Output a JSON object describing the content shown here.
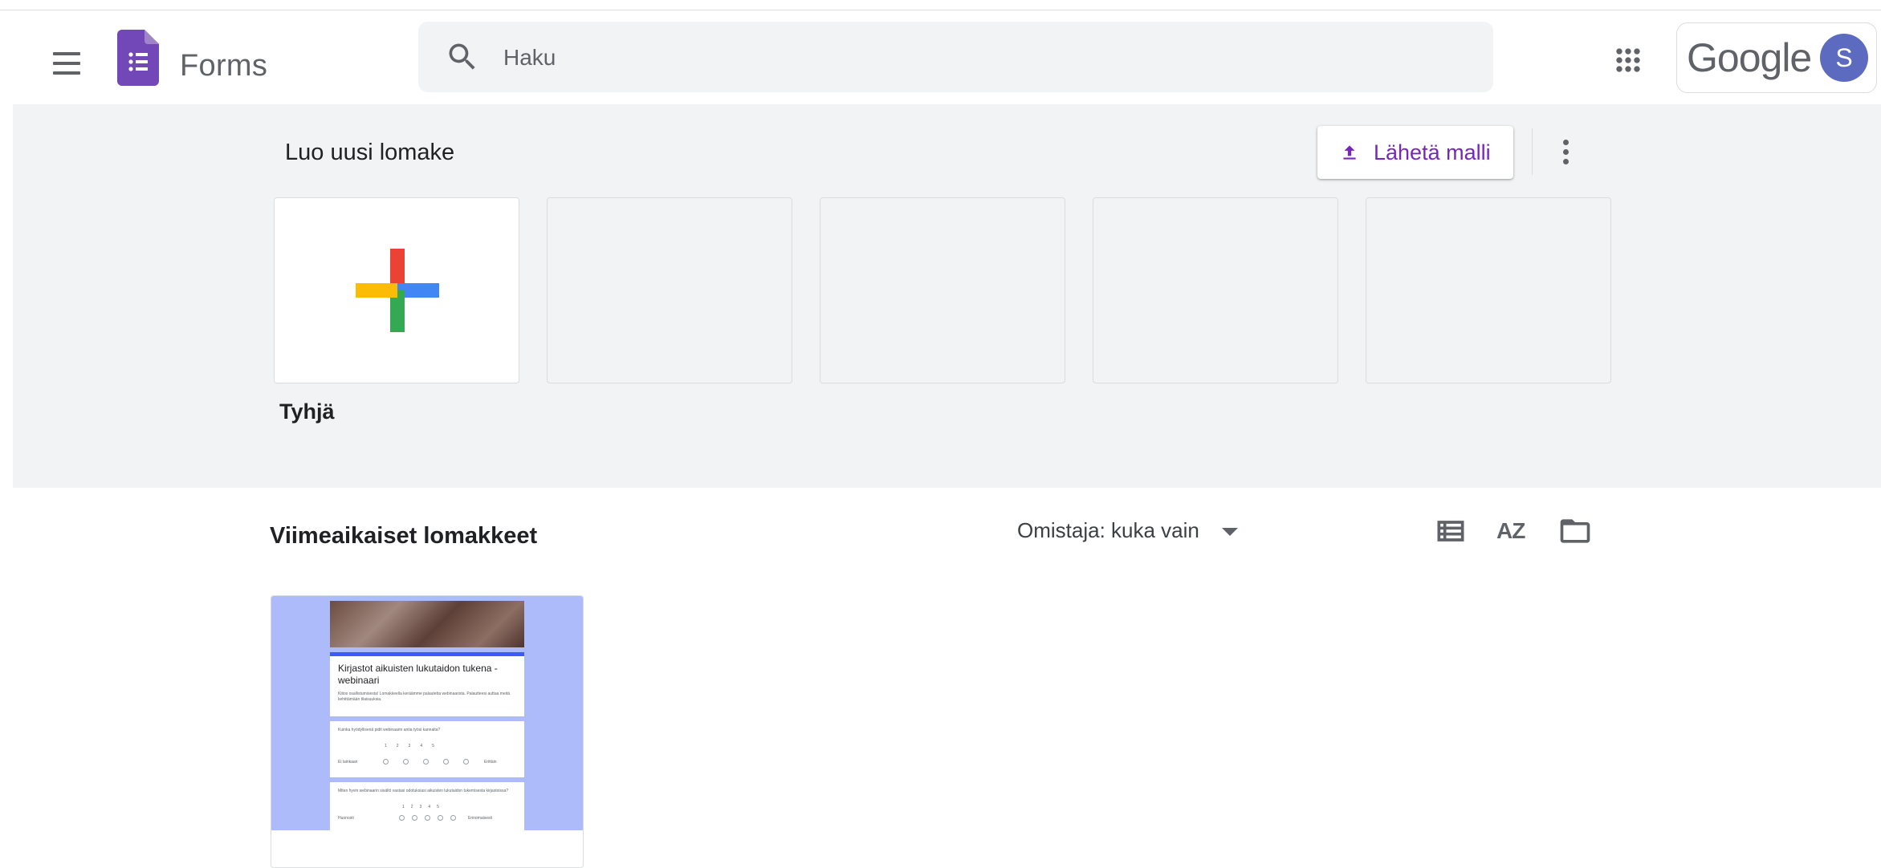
{
  "app": {
    "title": "Forms",
    "account_logo_text": "Google",
    "avatar_initial": "S"
  },
  "search": {
    "placeholder": "Haku"
  },
  "template_gallery": {
    "title": "Luo uusi lomake",
    "send_template_label": "Lähetä malli",
    "tiles": [
      {
        "label": "Tyhjä",
        "kind": "blank"
      },
      {
        "label": "",
        "kind": "placeholder"
      },
      {
        "label": "",
        "kind": "placeholder"
      },
      {
        "label": "",
        "kind": "placeholder"
      },
      {
        "label": "",
        "kind": "placeholder"
      }
    ]
  },
  "recent": {
    "title": "Viimeaikaiset lomakkeet",
    "owner_filter_label": "Omistaja: kuka vain",
    "sort_icon_text": "AZ",
    "forms": [
      {
        "thumb_title": "Kirjastot aikuisten lukutaidon tukena - webinaari",
        "thumb_desc": "Kiitos osallistumisesta! Lomakkeella keräämme palautetta webinaarista. Palautteesi auttaa meitä kehittämään tilaisuuksia.",
        "thumb_q1": "Kuinka hyödyllisenä pidit webinaarin antia työsi kannalta?",
        "thumb_q1_low": "Ei lainkaan",
        "thumb_q1_high": "Erittäin",
        "thumb_q2": "Miten hyvin webinaarin sisältö vastasi odotuksiasi aikuisten lukutaidon tukemisesta kirjastoissa?",
        "thumb_q2_low": "Huonosti",
        "thumb_q2_high": "Erinomaisesti",
        "thumb_scale": "12345"
      }
    ]
  },
  "colors": {
    "accent_purple": "#7627bb",
    "forms_logo": "#7248b9",
    "band_background": "#f1f3f4",
    "avatar": "#5c6bc0",
    "thumb_background": "#aebbfb"
  },
  "icons": [
    "menu-icon",
    "forms-logo-icon",
    "search-icon",
    "apps-grid-icon",
    "upload-icon",
    "more-vert-icon",
    "list-view-icon",
    "sort-az-icon",
    "folder-icon",
    "dropdown-arrow-icon"
  ]
}
